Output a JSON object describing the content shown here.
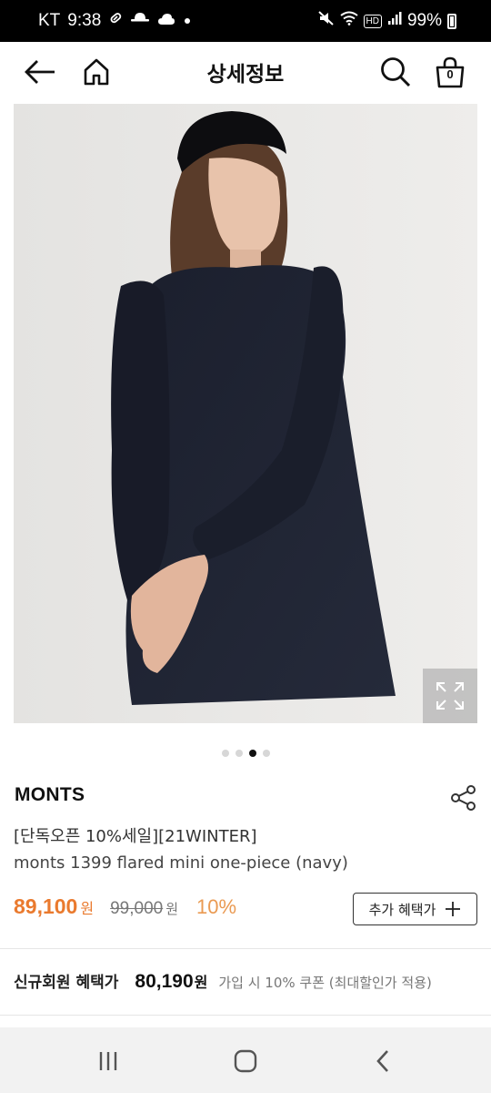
{
  "status_bar": {
    "carrier": "KT",
    "time": "9:38",
    "battery": "99%",
    "hd_label": "HD"
  },
  "header": {
    "title": "상세정보",
    "cart_count": "0"
  },
  "gallery": {
    "page_count": 4,
    "active_index": 2
  },
  "product": {
    "brand": "MONTS",
    "title_line1": "[단독오픈 10%세일][21WINTER]",
    "title_line2": "monts 1399 flared mini one-piece (navy)",
    "price": "89,100",
    "price_unit": "원",
    "original_price": "99,000",
    "original_unit": "원",
    "discount": "10%",
    "benefit_button": "추가 혜택가"
  },
  "member": {
    "label": "신규회원 혜택가",
    "price": "80,190",
    "unit": "원",
    "note": "가입 시 10% 쿠폰 (최대할인가 적용)"
  },
  "colors": {
    "accent_price": "#ea7a2e",
    "discount": "#ea9a52"
  }
}
